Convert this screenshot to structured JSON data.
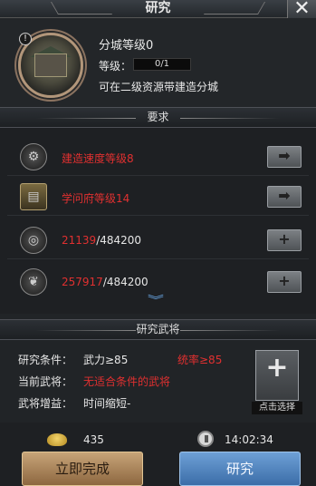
{
  "window": {
    "title": "研究",
    "close_glyph": "✕"
  },
  "head": {
    "name": "分城等级0",
    "level_label": "等级：",
    "level_progress": "0/1",
    "description": "可在二级资源带建造分城",
    "info_glyph": "!"
  },
  "requirements": {
    "header": "要求",
    "rows": [
      {
        "icon": "building-speed-icon",
        "text": "建造速度等级8",
        "action": "arrow"
      },
      {
        "icon": "academy-icon",
        "text": "学问府等级14",
        "action": "arrow"
      },
      {
        "icon": "coin-icon",
        "have": "21139",
        "need": "/484200",
        "action": "plus"
      },
      {
        "icon": "grain-icon",
        "have": "257917",
        "need": "/484200",
        "action": "plus"
      }
    ],
    "more_glyph": "︾"
  },
  "general": {
    "header": "研究武将",
    "condition_label": "研究条件：",
    "condition_force": "武力≥85",
    "condition_command": "统率≥85",
    "current_label": "当前武将：",
    "current_value": "无适合条件的武将",
    "bonus_label": "武将增益：",
    "bonus_value": "时间缩短-",
    "slot_plus": "+",
    "slot_label": "点击选择"
  },
  "footer": {
    "gold_cost": "435",
    "time_cost": "14:02:34",
    "instant_label": "立即完成",
    "research_label": "研究"
  },
  "colors": {
    "unmet": "#e03030",
    "primary_button": "#4d80bd",
    "gold_button": "#a9855a"
  }
}
